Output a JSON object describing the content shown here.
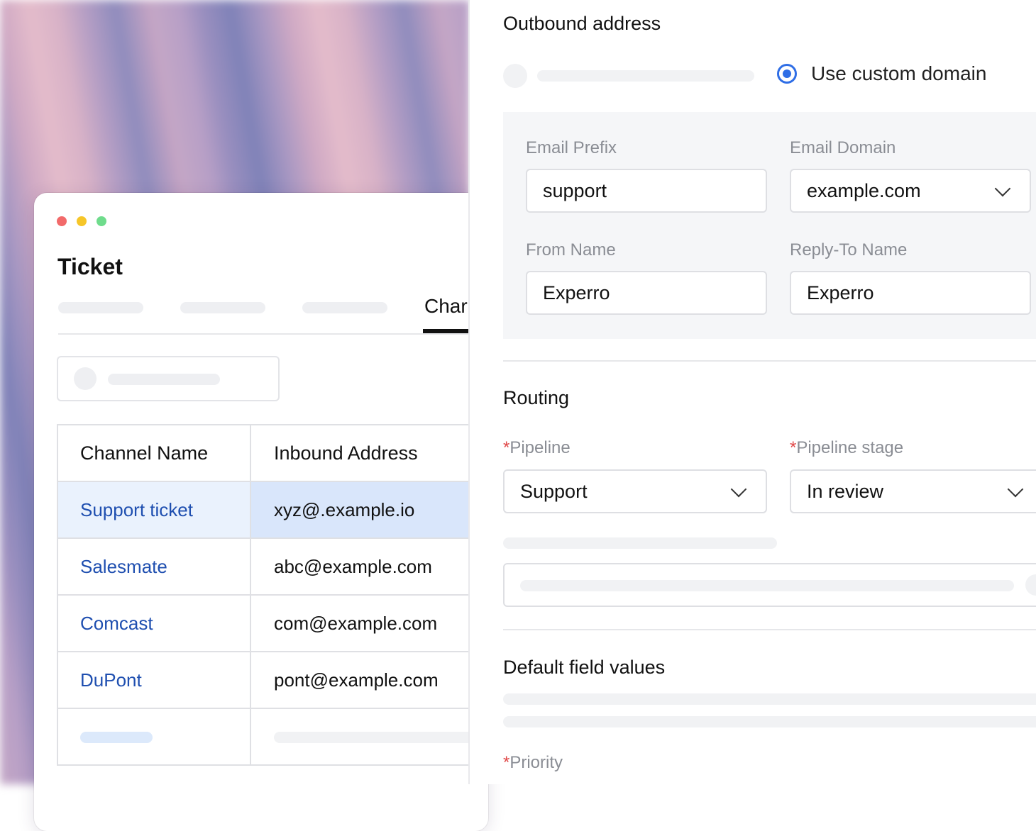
{
  "left_window": {
    "title": "Ticket",
    "active_tab_label": "Char",
    "table": {
      "headers": [
        "Channel Name",
        "Inbound Address"
      ],
      "rows": [
        {
          "name": "Support ticket",
          "address": "xyz@.example.io",
          "selected": true
        },
        {
          "name": "Salesmate",
          "address": "abc@example.com",
          "selected": false
        },
        {
          "name": "Comcast",
          "address": "com@example.com",
          "selected": false
        },
        {
          "name": "DuPont",
          "address": "pont@example.com",
          "selected": false
        }
      ]
    }
  },
  "right_panel": {
    "outbound_title": "Outbound address",
    "radio_option_label": "Use custom domain",
    "email_prefix_label": "Email Prefix",
    "email_prefix_value": "support",
    "email_domain_label": "Email Domain",
    "email_domain_value": "example.com",
    "from_name_label": "From Name",
    "from_name_value": "Experro",
    "reply_to_label": "Reply-To Name",
    "reply_to_value": "Experro",
    "routing_title": "Routing",
    "required_marker": "*",
    "pipeline_label": "Pipeline",
    "pipeline_value": "Support",
    "pipeline_stage_label": "Pipeline stage",
    "pipeline_stage_value": "In review",
    "default_fields_title": "Default field values",
    "priority_label": "Priority"
  },
  "colors": {
    "accent": "#2f6ee6",
    "link": "#1f4fb0",
    "required": "#e04848",
    "selected_row": "#d9e6fb"
  }
}
